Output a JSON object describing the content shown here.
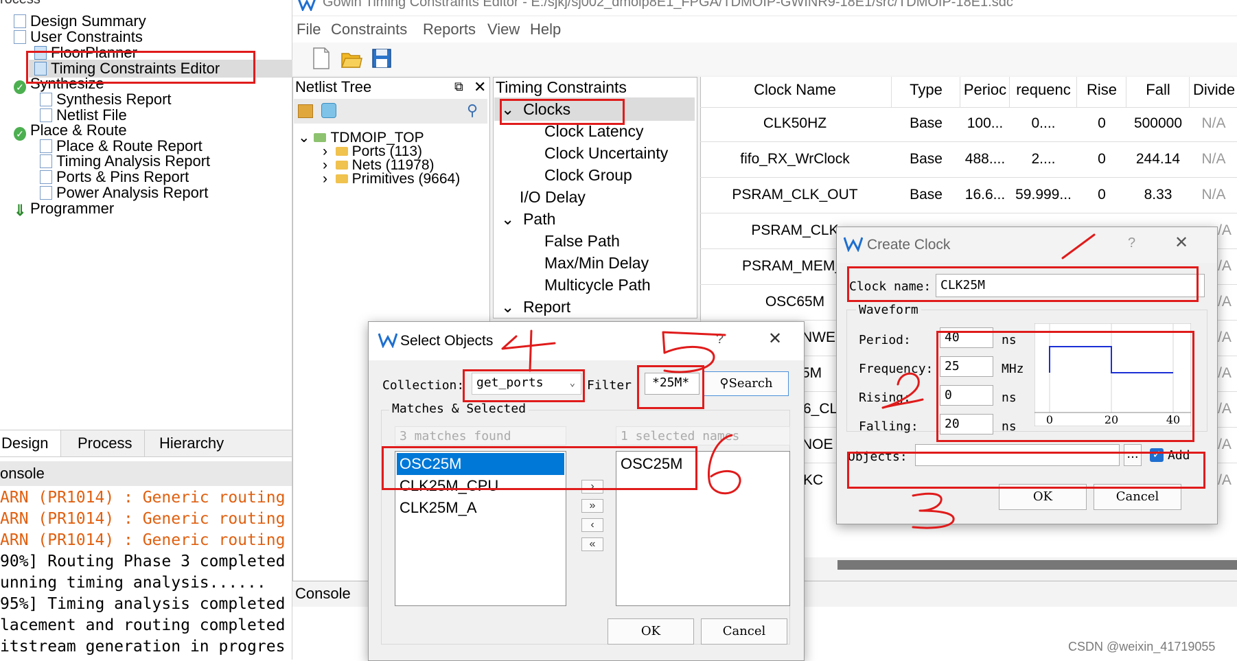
{
  "left_panel": {
    "top_label": "rocess",
    "tree": [
      {
        "label": "Design Summary",
        "icon": "doc-icon"
      },
      {
        "label": "User Constraints",
        "icon": "doc-icon"
      },
      {
        "label": "FloorPlanner",
        "icon": "floorplanner-icon"
      },
      {
        "label": "Timing Constraints Editor",
        "icon": "timing-editor-icon",
        "selected": true
      },
      {
        "label": "Synthesize",
        "icon": "check-icon"
      },
      {
        "label": "Synthesis Report",
        "icon": "doc-icon"
      },
      {
        "label": "Netlist File",
        "icon": "doc-icon"
      },
      {
        "label": "Place & Route",
        "icon": "check-icon"
      },
      {
        "label": "Place & Route Report",
        "icon": "doc-icon"
      },
      {
        "label": "Timing Analysis Report",
        "icon": "doc-icon"
      },
      {
        "label": "Ports & Pins Report",
        "icon": "doc-icon"
      },
      {
        "label": "Power Analysis Report",
        "icon": "doc-icon"
      },
      {
        "label": "Programmer",
        "icon": "download-icon"
      }
    ],
    "tabs": [
      "Design",
      "Process",
      "Hierarchy"
    ],
    "console_label": "onsole",
    "console_lines": [
      {
        "text": "ARN  (PR1014) : Generic routing",
        "warn": true
      },
      {
        "text": "ARN  (PR1014) : Generic routing",
        "warn": true
      },
      {
        "text": "ARN  (PR1014) : Generic routing",
        "warn": true
      },
      {
        "text": "90%] Routing Phase 3 completed",
        "warn": false
      },
      {
        "text": "unning timing analysis......",
        "warn": false
      },
      {
        "text": "95%] Timing analysis completed",
        "warn": false
      },
      {
        "text": "lacement and routing completed",
        "warn": false
      },
      {
        "text": "itstream generation in progres",
        "warn": false
      }
    ]
  },
  "editor": {
    "title": "Gowin Timing Constraints Editor - E:/sjkj/sj002_dmoip8E1_FPGA/TDMOIP-GWINR9-18E1/src/TDMOIP-18E1.sdc",
    "menu": [
      "File",
      "Constraints",
      "Reports",
      "View",
      "Help"
    ],
    "netlist": {
      "title": "Netlist Tree",
      "root": "TDMOIP_TOP",
      "children": [
        "Ports (113)",
        "Nets (11978)",
        "Primitives (9664)"
      ]
    },
    "constraints_tree": {
      "title": "Timing Constraints",
      "items": [
        {
          "label": "Clocks",
          "level": 0,
          "expand": "v",
          "selected": true
        },
        {
          "label": "Clock Latency",
          "level": 1
        },
        {
          "label": "Clock Uncertainty",
          "level": 1
        },
        {
          "label": "Clock Group",
          "level": 1
        },
        {
          "label": "I/O Delay",
          "level": 0
        },
        {
          "label": "Path",
          "level": 0,
          "expand": "v"
        },
        {
          "label": "False Path",
          "level": 1
        },
        {
          "label": "Max/Min Delay",
          "level": 1
        },
        {
          "label": "Multicycle Path",
          "level": 1
        },
        {
          "label": "Report",
          "level": 0,
          "expand": "v"
        }
      ]
    },
    "clock_table": {
      "headers": [
        "Clock Name",
        "Type",
        "Perioc",
        "requenc",
        "Rise",
        "Fall",
        "Divide"
      ],
      "rows": [
        [
          "CLK50HZ",
          "Base",
          "100...",
          "0....",
          "0",
          "500000",
          "N/A"
        ],
        [
          "fifo_RX_WrClock",
          "Base",
          "488....",
          "2....",
          "0",
          "244.14",
          "N/A"
        ],
        [
          "PSRAM_CLK_OUT",
          "Base",
          "16.6...",
          "59.999...",
          "0",
          "8.33",
          "N/A"
        ],
        [
          "PSRAM_CLK",
          "",
          "",
          "",
          "",
          "",
          "/A"
        ],
        [
          "PSRAM_MEM_(",
          "",
          "",
          "",
          "",
          "",
          "/A"
        ],
        [
          "OSC65M",
          "",
          "",
          "",
          "",
          "",
          "/A"
        ],
        [
          "NWE",
          "",
          "",
          "",
          "",
          "",
          "/A"
        ],
        [
          "5M",
          "",
          "",
          "",
          "",
          "",
          "/A"
        ],
        [
          "6_CL",
          "",
          "",
          "",
          "",
          "",
          "/A"
        ],
        [
          "NOE",
          "",
          "",
          "",
          "",
          "",
          "/A"
        ],
        [
          "KC",
          "",
          "",
          "",
          "",
          "",
          "/A"
        ]
      ]
    },
    "console_label": "Console"
  },
  "select_objects": {
    "title": "Select Objects",
    "help": "?",
    "collection_label": "Collection:",
    "collection_value": "get_ports",
    "filter_label": "Filter",
    "filter_value": "*25M*",
    "search_label": "Search",
    "group_label": "Matches & Selected",
    "matches_info": "3 matches found",
    "selected_info": "1 selected names",
    "matches": [
      "OSC25M",
      "CLK25M_CPU",
      "CLK25M_A"
    ],
    "selected": [
      "OSC25M"
    ],
    "ok": "OK",
    "cancel": "Cancel"
  },
  "create_clock": {
    "title": "Create Clock",
    "help": "?",
    "clock_name_label": "Clock name:",
    "clock_name_value": "CLK25M",
    "waveform_label": "Waveform",
    "period_label": "Period:",
    "period_value": "40",
    "period_unit": "ns",
    "frequency_label": "Frequency:",
    "frequency_value": "25",
    "frequency_unit": "MHz",
    "rising_label": "Rising:",
    "rising_value": "0",
    "rising_unit": "ns",
    "falling_label": "Falling:",
    "falling_value": "20",
    "falling_unit": "ns",
    "waveform_ticks": [
      "0",
      "20",
      "40"
    ],
    "objects_label": "Objects:",
    "objects_value": "",
    "browse_label": "...",
    "add_label": "Add",
    "add_checked": true,
    "ok": "OK",
    "cancel": "Cancel"
  },
  "colors": {
    "annotation_red": "#e01b1b",
    "selection_blue": "#0078d7",
    "warning_orange": "#e06010",
    "waveform_blue": "#1a2fd6"
  },
  "watermark": "CSDN @weixin_41719055"
}
